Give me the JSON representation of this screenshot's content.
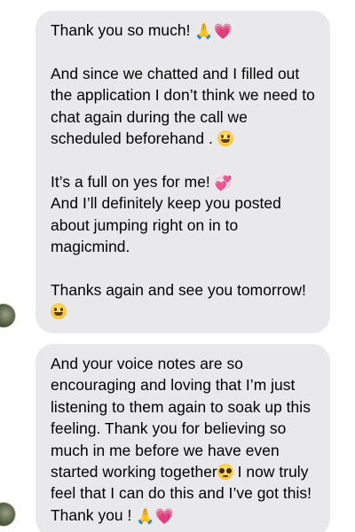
{
  "conversation": {
    "messages": [
      {
        "paragraphs": [
          {
            "text": "Thank you so much!",
            "emojis": [
              "pray",
              "heart"
            ]
          },
          {
            "text": "And since we chatted and I filled out the application I don’t think we need to chat again during the call we scheduled beforehand .",
            "emojis": [
              "smile"
            ]
          },
          {
            "text": "It’s a full on yes for me!",
            "emojis": [
              "twohearts"
            ],
            "continuation": "And I’ll definitely keep you posted about jumping right on in to magicmind."
          },
          {
            "text": "Thanks again and see you tomorrow!",
            "emojis": [
              "smile"
            ]
          }
        ]
      },
      {
        "paragraphs": [
          {
            "text_before": "And your voice notes  are so encouraging and loving that I’m just listening to them again to soak up this feeling. Thank you for believing so much in me before we have even started working together",
            "emoji_mid": "pleading",
            "text_after": " I now truly feel that I can do this and I’ve got this! Thank you !",
            "emojis": [
              "pray",
              "heart"
            ]
          }
        ]
      }
    ]
  },
  "emoji_glyphs": {
    "pray": "🙏",
    "heart": "💗",
    "twohearts": "💞",
    "smile": "",
    "pleading": ""
  },
  "colors": {
    "bubble": "#e9e9eb",
    "text": "#000000",
    "background": "#ffffff"
  }
}
